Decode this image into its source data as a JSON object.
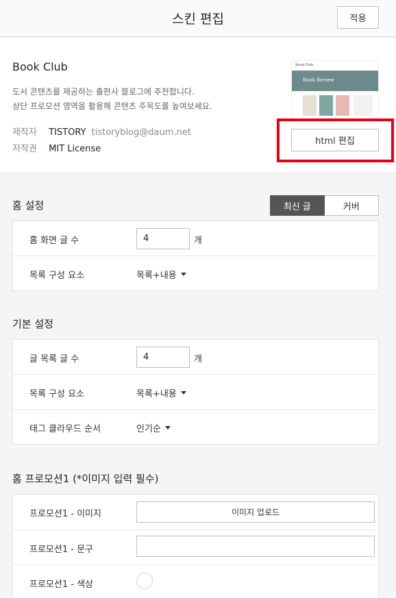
{
  "header": {
    "title": "스킨 편집",
    "apply_label": "적용"
  },
  "skin": {
    "name": "Book Club",
    "description_lines": [
      "도서 콘텐츠를 제공하는 출판사 블로그에 추천합니다.",
      "상단 프로모션 영역을 활용해 콘텐츠 주목도를 높여보세요."
    ],
    "author_label": "제작자",
    "author_name": "TISTORY",
    "author_email": "tistoryblog@daum.net",
    "license_label": "저작권",
    "license_value": "MIT License",
    "thumbnail": {
      "logo": "Book Club",
      "hero_text": "Book Review",
      "hero_color": "#6d8a8c"
    },
    "html_edit_label": "html 편집"
  },
  "home_settings": {
    "title": "홈 설정",
    "toggle": {
      "active": "최신 글",
      "inactive": "커버"
    },
    "rows": [
      {
        "label": "홈 화면 글 수",
        "value": "4",
        "unit": "개"
      },
      {
        "label": "목록 구성 요소",
        "value": "목록+내용"
      }
    ]
  },
  "basic_settings": {
    "title": "기본 설정",
    "rows": [
      {
        "label": "글 목록 글 수",
        "value": "4",
        "unit": "개"
      },
      {
        "label": "목록 구성 요소",
        "value": "목록+내용"
      },
      {
        "label": "태그 클라우드 순서",
        "value": "인기순"
      }
    ]
  },
  "promotion": {
    "title": "홈 프로모션1 (*이미지 입력 필수)",
    "rows": [
      {
        "label": "프로모션1 - 이미지",
        "button": "이미지 업로드"
      },
      {
        "label": "프로모션1 - 문구",
        "value": ""
      },
      {
        "label": "프로모션1 - 색상",
        "color": "#ffffff"
      }
    ]
  },
  "colors": {
    "accent_red": "#e60012",
    "toggle_active": "#555555"
  }
}
